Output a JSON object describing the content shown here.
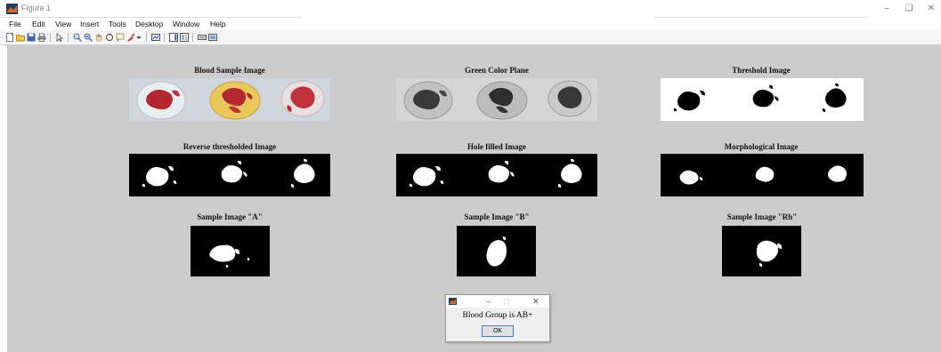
{
  "window": {
    "title": "Figure 1"
  },
  "menu": [
    "File",
    "Edit",
    "View",
    "Insert",
    "Tools",
    "Desktop",
    "Window",
    "Help"
  ],
  "toolbar_icons": [
    "new-figure-icon",
    "open-file-icon",
    "save-icon",
    "print-icon",
    "select-arrow-icon",
    "zoom-in-icon",
    "zoom-out-icon",
    "pan-icon",
    "rotate-3d-icon",
    "data-cursor-icon",
    "brush-icon",
    "brush-dropdown-icon",
    "link-plot-icon",
    "insert-colorbar-icon",
    "insert-legend-icon",
    "hide-plot-tools-icon",
    "show-plot-tools-icon"
  ],
  "axes": {
    "blood_sample": "Blood Sample Image",
    "green_plane": "Green Color Plane",
    "threshold": "Threshold Image",
    "reverse_threshold": "Reverse thresholded Image",
    "hole_filled": "Hole filled Image",
    "morphological": "Morphological Image",
    "sample_a": "Sample Image \"A\"",
    "sample_b": "Sample Image \"B\"",
    "sample_rh": "Sample Image \"Rh\""
  },
  "dialog": {
    "message": "Blood Group is AB+",
    "ok_label": "OK"
  },
  "colors": {
    "figure_bg": "#cccccc",
    "toolbar_bg": "#f5f5f5",
    "dialog_focus": "#3c7fd6",
    "blood_red": "#b3282f",
    "card_yellow": "#e8c85a"
  }
}
